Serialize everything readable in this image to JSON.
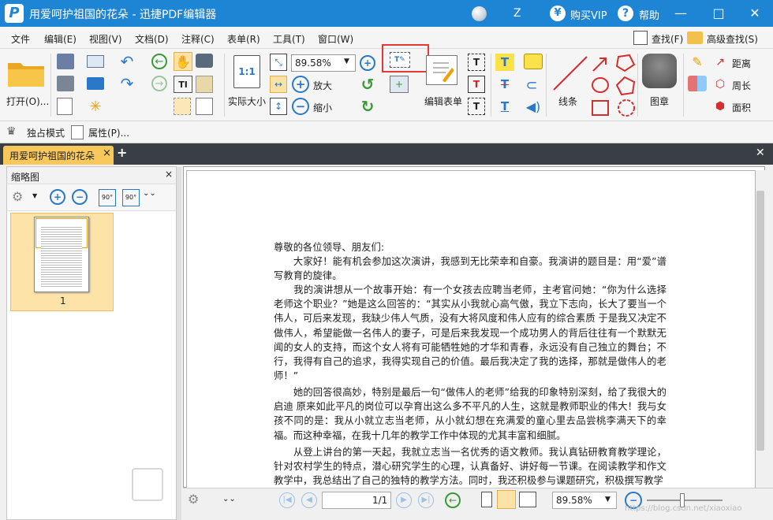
{
  "titlebar": {
    "app_logo": "P",
    "title": "用爱呵护祖国的花朵 - 迅捷PDF编辑器",
    "user": "Z",
    "vip_icon": "¥",
    "vip": "购买VIP",
    "help_icon": "?",
    "help": "帮助",
    "minimize": "—",
    "maximize": "□",
    "close": "✕"
  },
  "menu": {
    "items": [
      "文件",
      "编辑(E)",
      "视图(V)",
      "文档(D)",
      "注释(C)",
      "表单(R)",
      "工具(T)",
      "窗口(W)"
    ],
    "find": "查找(F)",
    "advanced_find": "高级查找(S)"
  },
  "toolbar": {
    "open": "打开(O)...",
    "actual_size": "实际大小",
    "actual_size_icon": "1:1",
    "zoom_value": "89.58%",
    "zoom_in": "放大",
    "zoom_out": "缩小",
    "edit_form": "编辑表单",
    "line": "线条",
    "stamp": "图章",
    "distance": "距离",
    "perimeter": "周长",
    "area": "面积",
    "highlight_color": "#e53935"
  },
  "subbar": {
    "exclusive": "独占模式",
    "properties": "属性(P)..."
  },
  "tabs": {
    "active": "用爱呵护祖国的花朵",
    "close": "×",
    "add": "+",
    "close_all": "✕"
  },
  "thumbnails": {
    "title": "缩略图",
    "close": "×",
    "page_label": "1",
    "rotate_left": "90°",
    "rotate_right": "90°"
  },
  "document": {
    "paragraphs": [
      "尊敬的各位领导、朋友们:",
      "　　大家好！能有机会参加这次演讲，我感到无比荣幸和自豪。我演讲的题目是：用“爱”谱写教育的旋律。",
      "　　我的演讲想从一个故事开始：有一个女孩去应聘当老师，主考官问她：“你为什么选择老师这个职业？”她是这么回答的：“其实从小我就心高气傲，我立下志向，长大了要当一个伟人，可后来发现，我缺少伟人气质，没有大将风度和伟人应有的综合素质 于是我又决定不做伟人，希望能做一名伟人的妻子，可是后来我发现一个成功男人的背后往往有一个默默无闻的女人的支持，而这个女人将有可能牺牲她的才华和青春，永远没有自己独立的舞台；不行，我得有自己的追求，我得实现自己的价值。最后我决定了我的选择，那就是做伟人的老师！”",
      "　　她的回答很高妙，特别是最后一句“做伟人的老师”给我的印象特别深刻，给了我很大的启迪 原来如此平凡的岗位可以孕育出这么多不平凡的人生，这就是教师职业的伟大！我与女孩不同的是：我从小就立志当老师，从小就幻想在充满爱的童心里去品尝桃李满天下的幸福。而这种幸福，在我十几年的教学工作中体现的尤其丰富和细腻。",
      "　　从登上讲台的第一天起，我就立志当一名优秀的语文教师。我认真钻研教育教学理论，针对农村学生的特点，潜心研究学生的心理，认真备好、讲好每一节课。在阅读教学和作文教学中，我总结出了自己的独特的教学方法。同时，我还积极参与课题研究，积极撰写教学"
    ]
  },
  "status": {
    "page_input": "1",
    "page_total": "1/1",
    "zoom": "89.58%",
    "watermark": "https://blog.csdn.net/xiaoxiao"
  }
}
